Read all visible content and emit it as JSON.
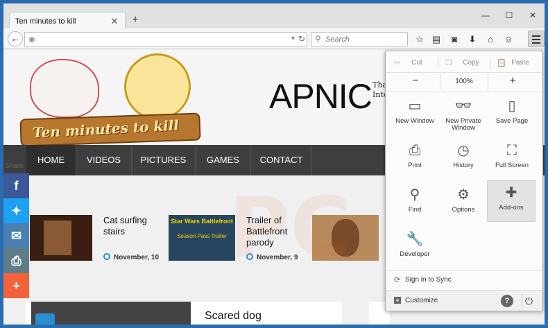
{
  "browser": {
    "tab_title": "Ten minutes to kill",
    "new_tab_label": "+",
    "search_placeholder": "Search",
    "url_value": ""
  },
  "site": {
    "logo_text": "Ten minutes to kill",
    "banner_brand": "APNIC",
    "banner_tagline_1": "Tha",
    "banner_tagline_2": "Inte",
    "nav": [
      "HOME",
      "VIDEOS",
      "PICTURES",
      "GAMES",
      "CONTACT"
    ],
    "share_label": "Share",
    "posts": [
      {
        "title": "Cat surfing stairs",
        "date": "November, 10",
        "thumb_color": "#3a1e12"
      },
      {
        "title": "Trailer of Battlefront parody",
        "date": "November, 9",
        "thumb_color": "#27455f",
        "thumb_text_1": "Star Wars Battlefront",
        "thumb_text_2": "Season Pass Trailer"
      },
      {
        "title": "",
        "date": "",
        "thumb_color": "#b98a5c"
      }
    ],
    "bottom_heading": "Scared dog"
  },
  "menu": {
    "cut": "Cut",
    "copy": "Copy",
    "paste": "Paste",
    "zoom_out": "−",
    "zoom_level": "100%",
    "zoom_in": "+",
    "items": [
      {
        "label": "New Window",
        "icon": "window-icon"
      },
      {
        "label": "New Private Window",
        "icon": "mask-icon"
      },
      {
        "label": "Save Page",
        "icon": "page-icon"
      },
      {
        "label": "Print",
        "icon": "printer-icon"
      },
      {
        "label": "History",
        "icon": "clock-icon"
      },
      {
        "label": "Full Screen",
        "icon": "fullscreen-icon"
      },
      {
        "label": "Find",
        "icon": "magnifier-icon"
      },
      {
        "label": "Options",
        "icon": "gear-icon"
      },
      {
        "label": "Add-ons",
        "icon": "puzzle-icon"
      },
      {
        "label": "Developer",
        "icon": "wrench-icon"
      }
    ],
    "sync": "Sign in to Sync",
    "customize": "Customize",
    "help": "?"
  },
  "colors": {
    "window_border": "#2a6cb0",
    "nav_bg": "#3e3e3e",
    "facebook": "#3b5998",
    "twitter": "#1da1f2",
    "email": "#4a7fb0",
    "print": "#5f7c8a",
    "plus": "#f4623a"
  }
}
